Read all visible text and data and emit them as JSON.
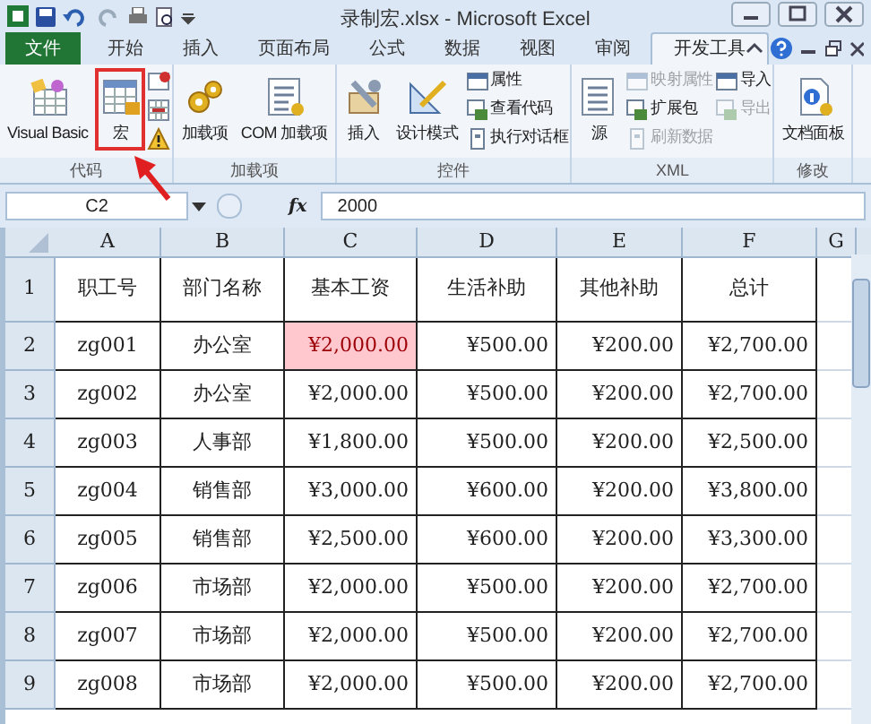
{
  "window": {
    "title": "录制宏.xlsx - Microsoft Excel"
  },
  "tabs": [
    {
      "label": "文件",
      "selected": false,
      "kind": "file"
    },
    {
      "label": "开始",
      "selected": false,
      "kind": "tab"
    },
    {
      "label": "插入",
      "selected": false,
      "kind": "tab"
    },
    {
      "label": "页面布局",
      "selected": false,
      "kind": "tab"
    },
    {
      "label": "公式",
      "selected": false,
      "kind": "tab"
    },
    {
      "label": "数据",
      "selected": false,
      "kind": "tab"
    },
    {
      "label": "视图",
      "selected": false,
      "kind": "tab"
    },
    {
      "label": "审阅",
      "selected": false,
      "kind": "tab"
    },
    {
      "label": "开发工具",
      "selected": true,
      "kind": "tab"
    }
  ],
  "ribbon": {
    "groups": [
      {
        "label": "代码",
        "kind": "code",
        "large": [
          {
            "label": "Visual Basic",
            "highlighted": false
          },
          {
            "label": "宏",
            "highlighted": true
          }
        ]
      },
      {
        "label": "加载项",
        "kind": "addins",
        "large": [
          {
            "label": "加载项",
            "highlighted": false
          },
          {
            "label": "COM 加载项",
            "highlighted": false
          }
        ]
      },
      {
        "label": "控件",
        "kind": "controls",
        "large": [
          {
            "label": "插入",
            "highlighted": false
          },
          {
            "label": "设计模式",
            "highlighted": false
          }
        ],
        "small": [
          {
            "label": "属性",
            "disabled": false
          },
          {
            "label": "查看代码",
            "disabled": false
          },
          {
            "label": "执行对话框",
            "disabled": false
          }
        ]
      },
      {
        "label": "XML",
        "kind": "xml",
        "large": [
          {
            "label": "源",
            "highlighted": false
          }
        ],
        "small": [
          {
            "label": "映射属性",
            "disabled": true
          },
          {
            "label": "扩展包",
            "disabled": false
          },
          {
            "label": "刷新数据",
            "disabled": true
          },
          {
            "label": "导入",
            "disabled": false
          },
          {
            "label": "导出",
            "disabled": true
          }
        ]
      },
      {
        "label": "修改",
        "kind": "modify",
        "large": [
          {
            "label": "文档面板",
            "highlighted": false
          }
        ]
      }
    ]
  },
  "formula_bar": {
    "name_box": "C2",
    "function_button": "fx",
    "formula": "2000"
  },
  "columns": [
    "A",
    "B",
    "C",
    "D",
    "E",
    "F",
    "G"
  ],
  "header_row": {
    "number": "1",
    "cells": [
      "职工号",
      "部门名称",
      "基本工资",
      "生活补助",
      "其他补助",
      "总计"
    ]
  },
  "rows": [
    {
      "number": "2",
      "cells": [
        {
          "text": "zg001",
          "selected": false
        },
        {
          "text": "办公室",
          "selected": false
        },
        {
          "text": "¥2,000.00",
          "selected": true
        },
        {
          "text": "¥500.00",
          "selected": false
        },
        {
          "text": "¥200.00",
          "selected": false
        },
        {
          "text": "¥2,700.00",
          "selected": false
        }
      ]
    },
    {
      "number": "3",
      "cells": [
        {
          "text": "zg002",
          "selected": false
        },
        {
          "text": "办公室",
          "selected": false
        },
        {
          "text": "¥2,000.00",
          "selected": false
        },
        {
          "text": "¥500.00",
          "selected": false
        },
        {
          "text": "¥200.00",
          "selected": false
        },
        {
          "text": "¥2,700.00",
          "selected": false
        }
      ]
    },
    {
      "number": "4",
      "cells": [
        {
          "text": "zg003",
          "selected": false
        },
        {
          "text": "人事部",
          "selected": false
        },
        {
          "text": "¥1,800.00",
          "selected": false
        },
        {
          "text": "¥500.00",
          "selected": false
        },
        {
          "text": "¥200.00",
          "selected": false
        },
        {
          "text": "¥2,500.00",
          "selected": false
        }
      ]
    },
    {
      "number": "5",
      "cells": [
        {
          "text": "zg004",
          "selected": false
        },
        {
          "text": "销售部",
          "selected": false
        },
        {
          "text": "¥3,000.00",
          "selected": false
        },
        {
          "text": "¥600.00",
          "selected": false
        },
        {
          "text": "¥200.00",
          "selected": false
        },
        {
          "text": "¥3,800.00",
          "selected": false
        }
      ]
    },
    {
      "number": "6",
      "cells": [
        {
          "text": "zg005",
          "selected": false
        },
        {
          "text": "销售部",
          "selected": false
        },
        {
          "text": "¥2,500.00",
          "selected": false
        },
        {
          "text": "¥600.00",
          "selected": false
        },
        {
          "text": "¥200.00",
          "selected": false
        },
        {
          "text": "¥3,300.00",
          "selected": false
        }
      ]
    },
    {
      "number": "7",
      "cells": [
        {
          "text": "zg006",
          "selected": false
        },
        {
          "text": "市场部",
          "selected": false
        },
        {
          "text": "¥2,000.00",
          "selected": false
        },
        {
          "text": "¥500.00",
          "selected": false
        },
        {
          "text": "¥200.00",
          "selected": false
        },
        {
          "text": "¥2,700.00",
          "selected": false
        }
      ]
    },
    {
      "number": "8",
      "cells": [
        {
          "text": "zg007",
          "selected": false
        },
        {
          "text": "市场部",
          "selected": false
        },
        {
          "text": "¥2,000.00",
          "selected": false
        },
        {
          "text": "¥500.00",
          "selected": false
        },
        {
          "text": "¥200.00",
          "selected": false
        },
        {
          "text": "¥2,700.00",
          "selected": false
        }
      ]
    },
    {
      "number": "9",
      "cells": [
        {
          "text": "zg008",
          "selected": false
        },
        {
          "text": "市场部",
          "selected": false
        },
        {
          "text": "¥2,000.00",
          "selected": false
        },
        {
          "text": "¥500.00",
          "selected": false
        },
        {
          "text": "¥200.00",
          "selected": false
        },
        {
          "text": "¥2,700.00",
          "selected": false
        }
      ]
    }
  ]
}
